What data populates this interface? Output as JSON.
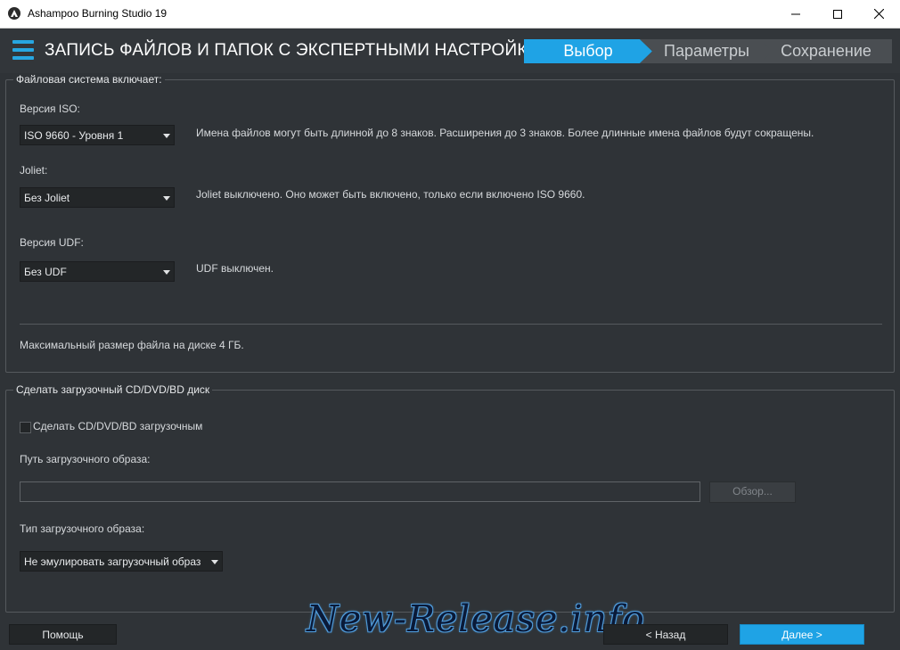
{
  "window": {
    "title": "Ashampoo Burning Studio 19"
  },
  "header": {
    "page_title": "ЗАПИСЬ ФАЙЛОВ И ПАПОК С ЭКСПЕРТНЫМИ НАСТРОЙК...",
    "steps": [
      {
        "label": "Выбор",
        "active": true
      },
      {
        "label": "Параметры",
        "active": false
      },
      {
        "label": "Сохранение",
        "active": false
      }
    ]
  },
  "filesystem": {
    "group_title": "Файловая система включает:",
    "iso": {
      "label": "Версия ISO:",
      "value": "ISO 9660 - Уровня 1",
      "description": "Имена файлов могут быть длинной до 8 знаков. Расширения до 3 знаков. Более длинные имена файлов будут сокращены."
    },
    "joliet": {
      "label": "Joliet:",
      "value": "Без Joliet",
      "description": "Joliet выключено. Оно может быть включено, только если включено ISO 9660."
    },
    "udf": {
      "label": "Версия UDF:",
      "value": "Без UDF",
      "description": "UDF выключен."
    },
    "max_file_size": "Максимальный размер файла на диске 4 ГБ."
  },
  "boot": {
    "group_title": "Сделать загрузочный CD/DVD/BD диск",
    "checkbox_label": "Сделать CD/DVD/BD загрузочным",
    "checked": false,
    "path_label": "Путь загрузочного образа:",
    "path_value": "",
    "browse_label": "Обзор...",
    "type_label": "Тип загрузочного образа:",
    "type_value": "Не эмулировать загрузочный образ"
  },
  "footer": {
    "help": "Помощь",
    "back": "< Назад",
    "next": "Далее >"
  },
  "watermark": "New-Release.info",
  "colors": {
    "accent": "#1fa3e5",
    "background": "#2f3337"
  }
}
